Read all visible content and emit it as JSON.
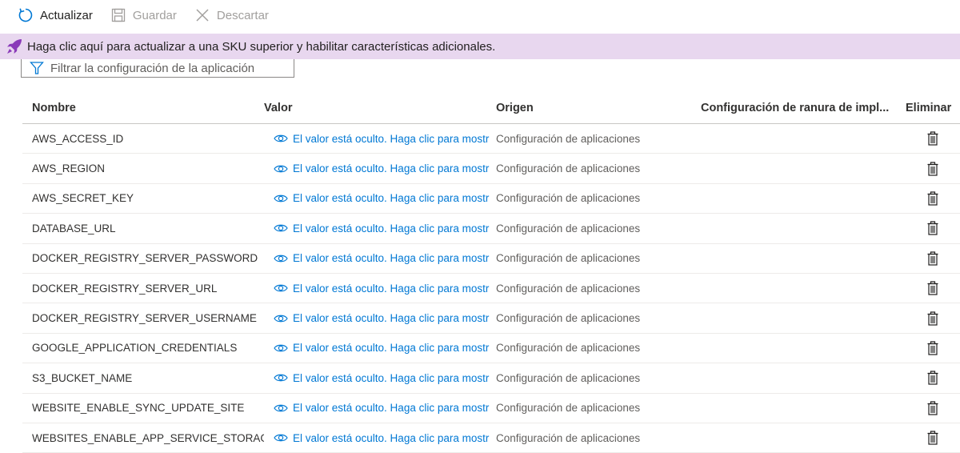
{
  "toolbar": {
    "refresh_label": "Actualizar",
    "save_label": "Guardar",
    "discard_label": "Descartar"
  },
  "banner": {
    "text": "Haga clic aquí para actualizar a una SKU superior y habilitar características adicionales."
  },
  "filter": {
    "placeholder": "Filtrar la configuración de la aplicación"
  },
  "table": {
    "headers": {
      "name": "Nombre",
      "value": "Valor",
      "origin": "Origen",
      "slot": "Configuración de ranura de impl...",
      "delete": "Eliminar"
    },
    "rows": [
      {
        "name": "AWS_ACCESS_ID",
        "value": "El valor está oculto. Haga clic para mostr",
        "origin": "Configuración de aplicaciones"
      },
      {
        "name": "AWS_REGION",
        "value": "El valor está oculto. Haga clic para mostr",
        "origin": "Configuración de aplicaciones"
      },
      {
        "name": "AWS_SECRET_KEY",
        "value": "El valor está oculto. Haga clic para mostr",
        "origin": "Configuración de aplicaciones"
      },
      {
        "name": "DATABASE_URL",
        "value": "El valor está oculto. Haga clic para mostr",
        "origin": "Configuración de aplicaciones"
      },
      {
        "name": "DOCKER_REGISTRY_SERVER_PASSWORD",
        "value": "El valor está oculto. Haga clic para mostr",
        "origin": "Configuración de aplicaciones"
      },
      {
        "name": "DOCKER_REGISTRY_SERVER_URL",
        "value": "El valor está oculto. Haga clic para mostr",
        "origin": "Configuración de aplicaciones"
      },
      {
        "name": "DOCKER_REGISTRY_SERVER_USERNAME",
        "value": "El valor está oculto. Haga clic para mostr",
        "origin": "Configuración de aplicaciones"
      },
      {
        "name": "GOOGLE_APPLICATION_CREDENTIALS",
        "value": "El valor está oculto. Haga clic para mostr",
        "origin": "Configuración de aplicaciones"
      },
      {
        "name": "S3_BUCKET_NAME",
        "value": "El valor está oculto. Haga clic para mostr",
        "origin": "Configuración de aplicaciones"
      },
      {
        "name": "WEBSITE_ENABLE_SYNC_UPDATE_SITE",
        "value": "El valor está oculto. Haga clic para mostr",
        "origin": "Configuración de aplicaciones"
      },
      {
        "name": "WEBSITES_ENABLE_APP_SERVICE_STORAGE",
        "value": "El valor está oculto. Haga clic para mostr",
        "origin": "Configuración de aplicaciones"
      }
    ]
  },
  "icons": {
    "refresh": "refresh-icon",
    "save": "save-icon",
    "discard": "close-icon",
    "banner": "rocket-icon",
    "filter": "filter-icon",
    "value": "eye-icon",
    "delete": "trash-icon"
  },
  "colors": {
    "accent": "#0078d4",
    "banner_bg": "#e8d7ef",
    "rocket": "#8a3ab9",
    "disabled": "#a19f9d"
  }
}
